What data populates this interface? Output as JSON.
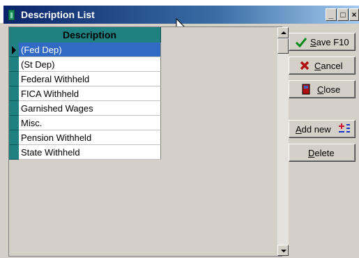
{
  "window": {
    "title": "Description List"
  },
  "grid": {
    "header": "Description",
    "rows": [
      "(Fed Dep)",
      "(St Dep)",
      "Federal Withheld",
      "FICA Withheld",
      "Garnished Wages",
      "Misc.",
      "Pension Withheld",
      "State Withheld"
    ],
    "selected_index": 0
  },
  "buttons": {
    "save": {
      "prefix": "",
      "accel": "S",
      "rest": "ave F10",
      "icon": "checkmark-icon"
    },
    "cancel": {
      "prefix": "",
      "accel": "C",
      "rest": "ancel",
      "icon": "red-x-icon"
    },
    "close": {
      "prefix": "",
      "accel": "C",
      "rest": "lose",
      "icon": "door-icon"
    },
    "add_new": {
      "prefix": "",
      "accel": "A",
      "rest": "dd new",
      "icon": "add-rows-icon"
    },
    "delete": {
      "prefix": "",
      "accel": "D",
      "rest": "elete"
    }
  },
  "titlebar_buttons": {
    "minimize": "_",
    "maximize": "□",
    "close": "×"
  },
  "colors": {
    "title_start": "#0a246a",
    "grid_header": "#1e8080",
    "selection": "#316ac5"
  }
}
